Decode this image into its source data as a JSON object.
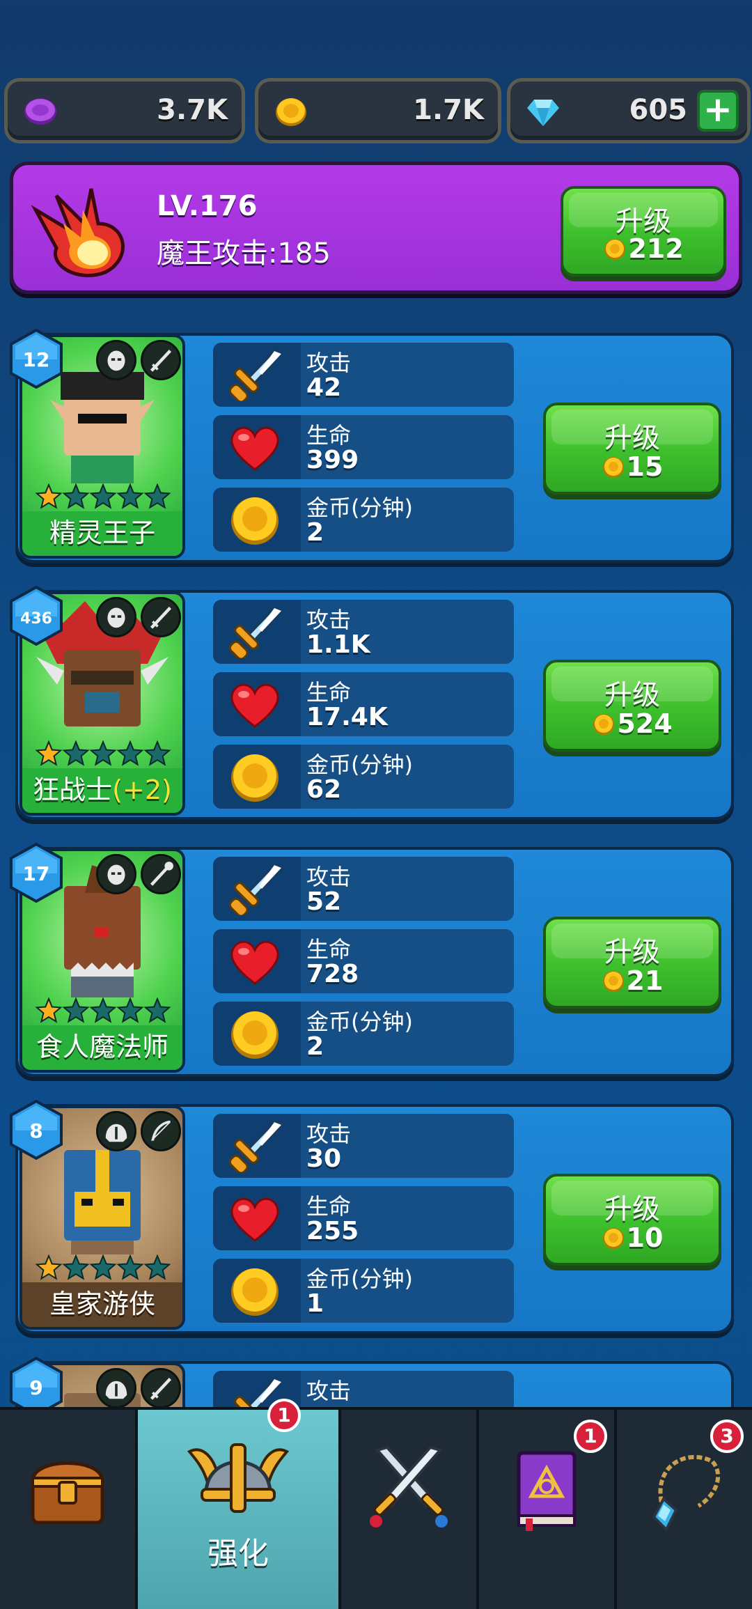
{
  "currency": {
    "purple": "3.7K",
    "gold": "1.7K",
    "gems": "605",
    "add_label": "+"
  },
  "demon_king": {
    "level": "LV.176",
    "attack_label": "魔王攻击:185",
    "upgrade_label": "升级",
    "upgrade_cost": "212"
  },
  "labels": {
    "attack": "攻击",
    "health": "生命",
    "gold_per_min": "金币(分钟)",
    "upgrade": "升级"
  },
  "heroes": [
    {
      "level": "12",
      "name": "精灵王子",
      "bonus": "",
      "stars": 1,
      "attack": "42",
      "health": "399",
      "gold": "2",
      "cost": "15",
      "theme": "green"
    },
    {
      "level": "436",
      "name": "狂战士",
      "bonus": "(+2)",
      "stars": 1,
      "attack": "1.1K",
      "health": "17.4K",
      "gold": "62",
      "cost": "524",
      "theme": "green"
    },
    {
      "level": "17",
      "name": "食人魔法师",
      "bonus": "",
      "stars": 1,
      "attack": "52",
      "health": "728",
      "gold": "2",
      "cost": "21",
      "theme": "green"
    },
    {
      "level": "8",
      "name": "皇家游侠",
      "bonus": "",
      "stars": 1,
      "attack": "30",
      "health": "255",
      "gold": "1",
      "cost": "10",
      "theme": "brown"
    },
    {
      "level": "9",
      "name": "",
      "bonus": "",
      "stars": 0,
      "attack": "",
      "health": "",
      "gold": "",
      "cost": "",
      "theme": "brown"
    }
  ],
  "tabs": [
    {
      "name": "chest",
      "label": "",
      "badge": ""
    },
    {
      "name": "upgrade",
      "label": "强化",
      "badge": "1",
      "active": true
    },
    {
      "name": "battle",
      "label": "",
      "badge": ""
    },
    {
      "name": "spellbook",
      "label": "",
      "badge": "1"
    },
    {
      "name": "amulet",
      "label": "",
      "badge": "3"
    }
  ]
}
